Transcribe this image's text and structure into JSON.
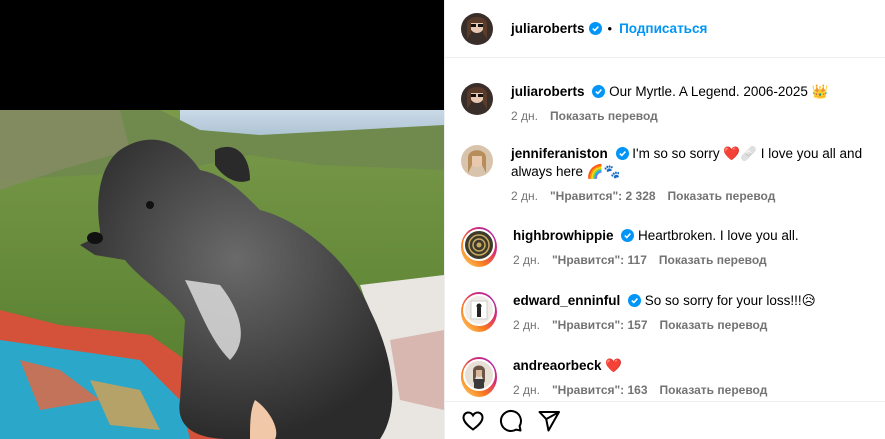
{
  "header": {
    "username": "juliaroberts",
    "separator": "•",
    "follow_label": "Подписаться",
    "verified_icon": "verified-badge-icon"
  },
  "caption": {
    "username": "juliaroberts",
    "text": "Our Myrtle. A Legend. 2006-2025 👑",
    "time": "2 дн.",
    "translate": "Показать перевод"
  },
  "comments": [
    {
      "username": "jenniferaniston",
      "verified": true,
      "text": "I'm so so sorry ❤️🩹 I love you all and always here 🌈🐾",
      "time": "2 дн.",
      "likes": "\"Нравится\": 2 328",
      "translate": "Показать перевод"
    },
    {
      "username": "highbrowhippie",
      "verified": true,
      "text": "Heartbroken. I love you all.",
      "time": "2 дн.",
      "likes": "\"Нравится\": 117",
      "translate": "Показать перевод"
    },
    {
      "username": "edward_enninful",
      "verified": true,
      "text": "So so sorry for your loss!!!😥",
      "time": "2 дн.",
      "likes": "\"Нравится\": 157",
      "translate": "Показать перевод"
    },
    {
      "username": "andreaorbeck",
      "verified": false,
      "text": "❤️",
      "time": "2 дн.",
      "likes": "\"Нравится\": 163",
      "translate": "Показать перевод"
    }
  ],
  "actions": {
    "like_icon": "heart-icon",
    "comment_icon": "comment-icon",
    "share_icon": "share-icon"
  },
  "colors": {
    "link": "#0095f6",
    "verified": "#0095f6",
    "meta_text": "#737373"
  }
}
